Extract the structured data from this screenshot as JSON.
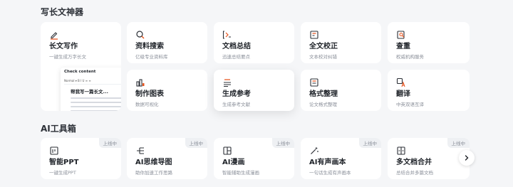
{
  "sections": {
    "writing_title": "写长文神器",
    "tools_title": "AI工具箱"
  },
  "writing_cards": [
    {
      "title": "长文写作",
      "desc": "一键生成万字长文",
      "icon": "pen-icon"
    },
    {
      "title": "资料搜索",
      "desc": "亿级专业资料库",
      "icon": "search-icon"
    },
    {
      "title": "文档总结",
      "desc": "迅速总结要点",
      "icon": "summary-icon"
    },
    {
      "title": "全文校正",
      "desc": "文本校对纠错",
      "icon": "proofread-icon"
    },
    {
      "title": "查重",
      "desc": "权威机构服务",
      "icon": "plagiarism-check-icon"
    },
    {
      "title": "制作图表",
      "desc": "数据可视化",
      "icon": "chart-icon"
    },
    {
      "title": "生成参考",
      "desc": "生成参考文献",
      "icon": "reference-icon"
    },
    {
      "title": "格式整理",
      "desc": "论文格式整理",
      "icon": "format-icon"
    },
    {
      "title": "翻译",
      "desc": "中英双语互译",
      "icon": "translate-icon"
    }
  ],
  "preview": {
    "header": "Check content",
    "toolbar": "Normal ▾   B  I  U  ≡  ≡",
    "doc_title": "帮我写一篇长文..."
  },
  "tool_cards": [
    {
      "title": "智能PPT",
      "desc": "一键生成PPT",
      "badge": "上线中",
      "icon": "ppt-icon"
    },
    {
      "title": "AI思维导图",
      "desc": "助你加速工作思路",
      "badge": "上线中",
      "icon": "mindmap-icon"
    },
    {
      "title": "AI漫画",
      "desc": "智能辅助生成漫画",
      "badge": "上线中",
      "icon": "comic-icon"
    },
    {
      "title": "AI有声画本",
      "desc": "一句话生成有声画本",
      "badge": "上线中",
      "icon": "magic-wand-icon"
    },
    {
      "title": "多文档合并",
      "desc": "总结合并多篇文档",
      "badge": "上线中",
      "icon": "merge-icon"
    }
  ],
  "colors": {
    "accent": "#e8541e",
    "background": "#f5f6f8",
    "card": "#ffffff",
    "text": "#1f2329",
    "muted": "#8a8f99"
  }
}
